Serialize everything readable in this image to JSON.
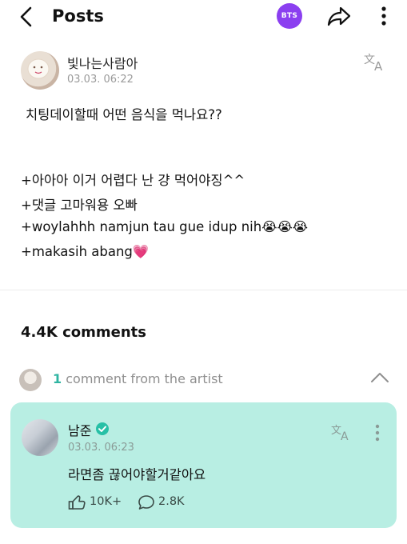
{
  "header": {
    "title": "Posts",
    "community_badge": "BTS",
    "accent": "#8b3ff0"
  },
  "post": {
    "author": "빛나는사람아",
    "time": "03.03. 06:22",
    "lines": [
      "치팅데이할때 어떤 음식을 먹나요??",
      "+아아아 이거 어렵다 난 걍 먹어야징^^",
      "+댓글 고마워용 오빠",
      "+woylahhh namjun tau gue idup nih😭😭😭",
      "+makasih abang💗"
    ]
  },
  "comments": {
    "count_label": "4.4K comments",
    "artist_count": "1",
    "artist_label": " comment from the artist",
    "artist_comment": {
      "name": "남준",
      "time": "03.03. 06:23",
      "text": "라면좀 끊어야할거같아요",
      "likes": "10K+",
      "replies": "2.8K",
      "card_color": "#b8eee3",
      "verified_color": "#26c0a6"
    }
  }
}
